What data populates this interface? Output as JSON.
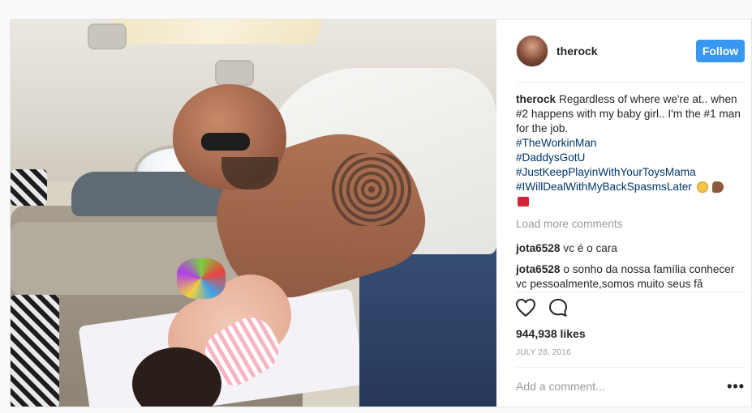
{
  "post": {
    "username": "therock",
    "follow_label": "Follow",
    "caption": {
      "author": "therock",
      "text": "Regardless of where we're at.. when #2 happens with my baby girl.. I'm the #1 man for the job.",
      "hashtags": [
        "#TheWorkinMan",
        "#DaddysGotU",
        "#JustKeepPlayinWithYourToysMama",
        "#IWillDealWithMyBackSpasmsLater"
      ],
      "emojis": [
        "grimacing-face-emoji",
        "flexed-biceps-emoji",
        "hundred-points-emoji"
      ]
    },
    "load_more_label": "Load more comments",
    "comments": [
      {
        "author": "jota6528",
        "text": "vc é o cara"
      },
      {
        "author": "jota6528",
        "text": "o sonho da nossa família conhecer vc pessoalmente,somos muito seus fã"
      }
    ],
    "likes": "944,938 likes",
    "date": "JULY 28, 2016",
    "add_comment_placeholder": "Add a comment...",
    "more_options": "•••"
  },
  "colors": {
    "accent": "#3897f0",
    "hashtag": "#003569",
    "muted": "#999999"
  }
}
